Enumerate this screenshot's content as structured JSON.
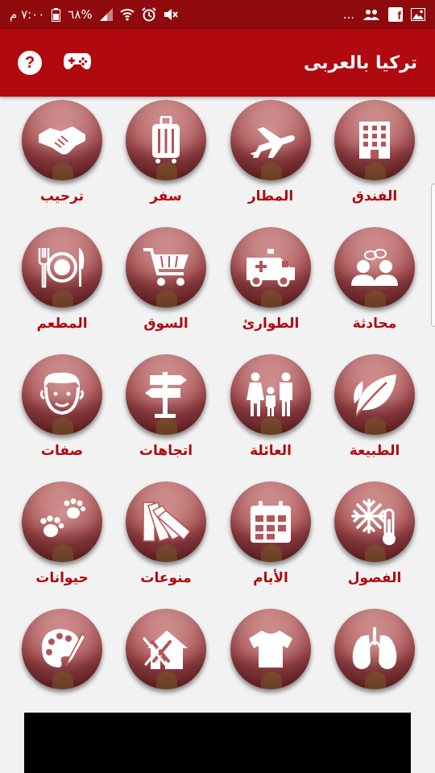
{
  "status_bar": {
    "time": "٧:٠٠ م",
    "battery": "٦٨%",
    "more": "..."
  },
  "app_bar": {
    "title": "تركيا بالعربى",
    "help_label": "?"
  },
  "tiles": [
    {
      "label": "الفندق",
      "icon": "hotel-icon"
    },
    {
      "label": "المطار",
      "icon": "airplane-icon"
    },
    {
      "label": "سفر",
      "icon": "suitcase-icon"
    },
    {
      "label": "ترحيب",
      "icon": "handshake-icon"
    },
    {
      "label": "محادثة",
      "icon": "conversation-icon"
    },
    {
      "label": "الطوارئ",
      "icon": "ambulance-icon"
    },
    {
      "label": "السوق",
      "icon": "cart-icon"
    },
    {
      "label": "المطعم",
      "icon": "plate-cutlery-icon"
    },
    {
      "label": "الطبيعة",
      "icon": "leaf-icon"
    },
    {
      "label": "العائلة",
      "icon": "family-icon"
    },
    {
      "label": "اتجاهات",
      "icon": "signpost-icon"
    },
    {
      "label": "صفات",
      "icon": "face-icon"
    },
    {
      "label": "الفصول",
      "icon": "snowflake-thermometer-icon"
    },
    {
      "label": "الأيام",
      "icon": "calendar-icon"
    },
    {
      "label": "منوعات",
      "icon": "swatches-icon"
    },
    {
      "label": "حيوانات",
      "icon": "paw-icon"
    },
    {
      "label": "",
      "icon": "lungs-icon"
    },
    {
      "label": "",
      "icon": "tshirt-icon"
    },
    {
      "label": "",
      "icon": "house-tools-icon"
    },
    {
      "label": "",
      "icon": "palette-icon"
    }
  ]
}
